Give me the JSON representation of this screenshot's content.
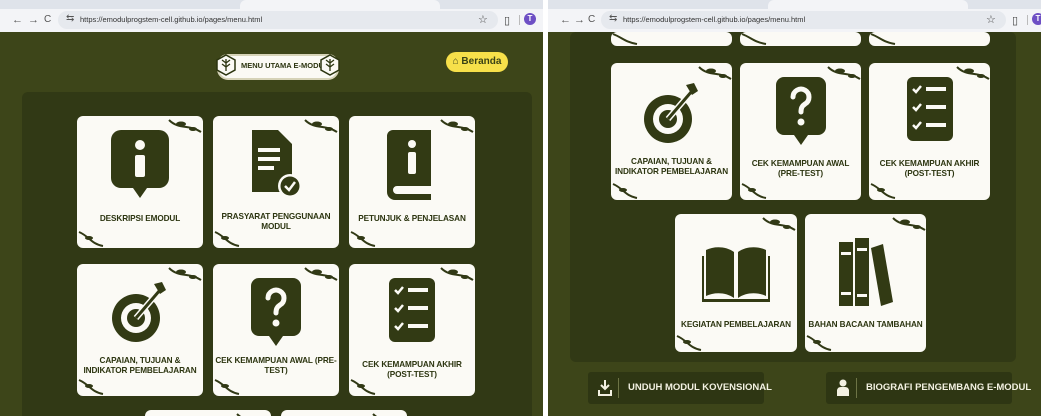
{
  "left_window": {
    "url": "https://emodulprogstem-cell.github.io/pages/menu.html",
    "header": {
      "title": "MENU UTAMA E-MODUL",
      "home_button": "Beranda"
    },
    "cards": [
      {
        "icon": "info-icon",
        "label": "DESKRIPSI EMODUL"
      },
      {
        "icon": "document-check-icon",
        "label": "PRASYARAT PENGGUNAAN MODUL"
      },
      {
        "icon": "manual-book-icon",
        "label": "PETUNJUK & PENJELASAN"
      },
      {
        "icon": "target-icon",
        "label": "CAPAIAN, TUJUAN & INDIKATOR PEMBELAJARAN"
      },
      {
        "icon": "question-icon",
        "label": "CEK KEMAMPUAN AWAL (PRE-TEST)"
      },
      {
        "icon": "checklist-icon",
        "label": "CEK KEMAMPUAN AKHIR (POST-TEST)"
      }
    ]
  },
  "right_window": {
    "url": "https://emodulprogstem-cell.github.io/pages/menu.html",
    "cards": [
      {
        "icon": "target-icon",
        "label": "CAPAIAN, TUJUAN & INDIKATOR PEMBELAJARAN"
      },
      {
        "icon": "question-icon",
        "label": "CEK KEMAMPUAN AWAL (PRE-TEST)"
      },
      {
        "icon": "checklist-icon",
        "label": "CEK KEMAMPUAN AKHIR (POST-TEST)"
      },
      {
        "icon": "open-book-icon",
        "label": "KEGIATAN PEMBELAJARAN"
      },
      {
        "icon": "books-icon",
        "label": "BAHAN BACAAN TAMBAHAN"
      }
    ],
    "buttons": [
      {
        "icon": "download-icon",
        "label": "UNDUH MODUL KOVENSIONAL"
      },
      {
        "icon": "person-icon",
        "label": "BIOGRAFI PENGEMBANG E-MODUL"
      }
    ]
  },
  "browser": {
    "back": "←",
    "forward": "→",
    "reload": "C",
    "star": "☆",
    "profile": "T"
  },
  "colors": {
    "background": "#3d4519",
    "panel": "#313915",
    "card": "#fbfaf5",
    "icon": "#323a14",
    "accent": "#f7e04a"
  }
}
